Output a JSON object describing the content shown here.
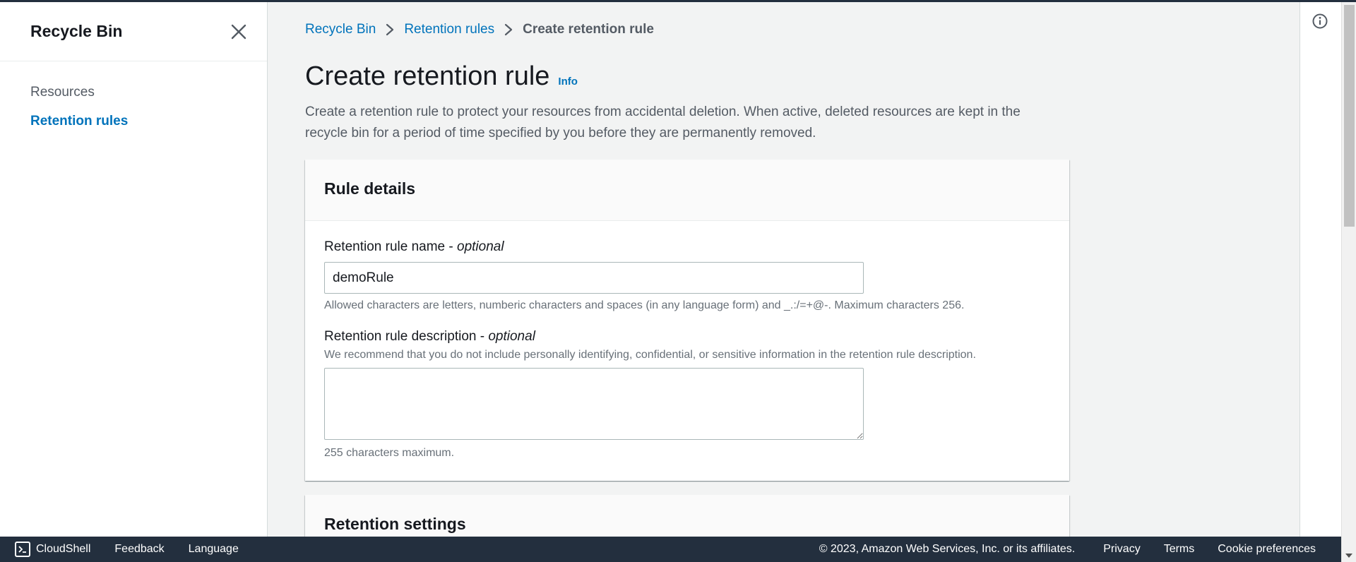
{
  "sidebar": {
    "title": "Recycle Bin",
    "close_icon": "close-icon",
    "items": [
      {
        "label": "Resources",
        "active": false
      },
      {
        "label": "Retention rules",
        "active": true
      }
    ]
  },
  "breadcrumb": {
    "items": [
      "Recycle Bin",
      "Retention rules"
    ],
    "current": "Create retention rule",
    "separator_icon": "chevron-right-icon"
  },
  "page": {
    "title": "Create retention rule",
    "info_label": "Info",
    "description": "Create a retention rule to protect your resources from accidental deletion. When active, deleted resources are kept in the recycle bin for a period of time specified by you before they are permanently removed."
  },
  "rule_details": {
    "title": "Rule details",
    "name_label": "Retention rule name -",
    "name_optional": "optional",
    "name_value": "demoRule",
    "name_hint": "Allowed characters are letters, numberic characters and spaces (in any language form) and _.:/=+@-. Maximum characters 256.",
    "desc_label": "Retention rule description -",
    "desc_optional": "optional",
    "desc_hint": "We recommend that you do not include personally identifying, confidential, or sensitive information in the retention rule description.",
    "desc_value": "",
    "desc_limit": "255 characters maximum."
  },
  "retention_settings": {
    "title": "Retention settings"
  },
  "footer": {
    "cloudshell": "CloudShell",
    "feedback": "Feedback",
    "language": "Language",
    "copyright": "© 2023, Amazon Web Services, Inc. or its affiliates.",
    "privacy": "Privacy",
    "terms": "Terms",
    "cookie": "Cookie preferences"
  },
  "colors": {
    "link": "#0073bb",
    "footer_bg": "#232f3e",
    "page_bg": "#f2f3f3"
  }
}
